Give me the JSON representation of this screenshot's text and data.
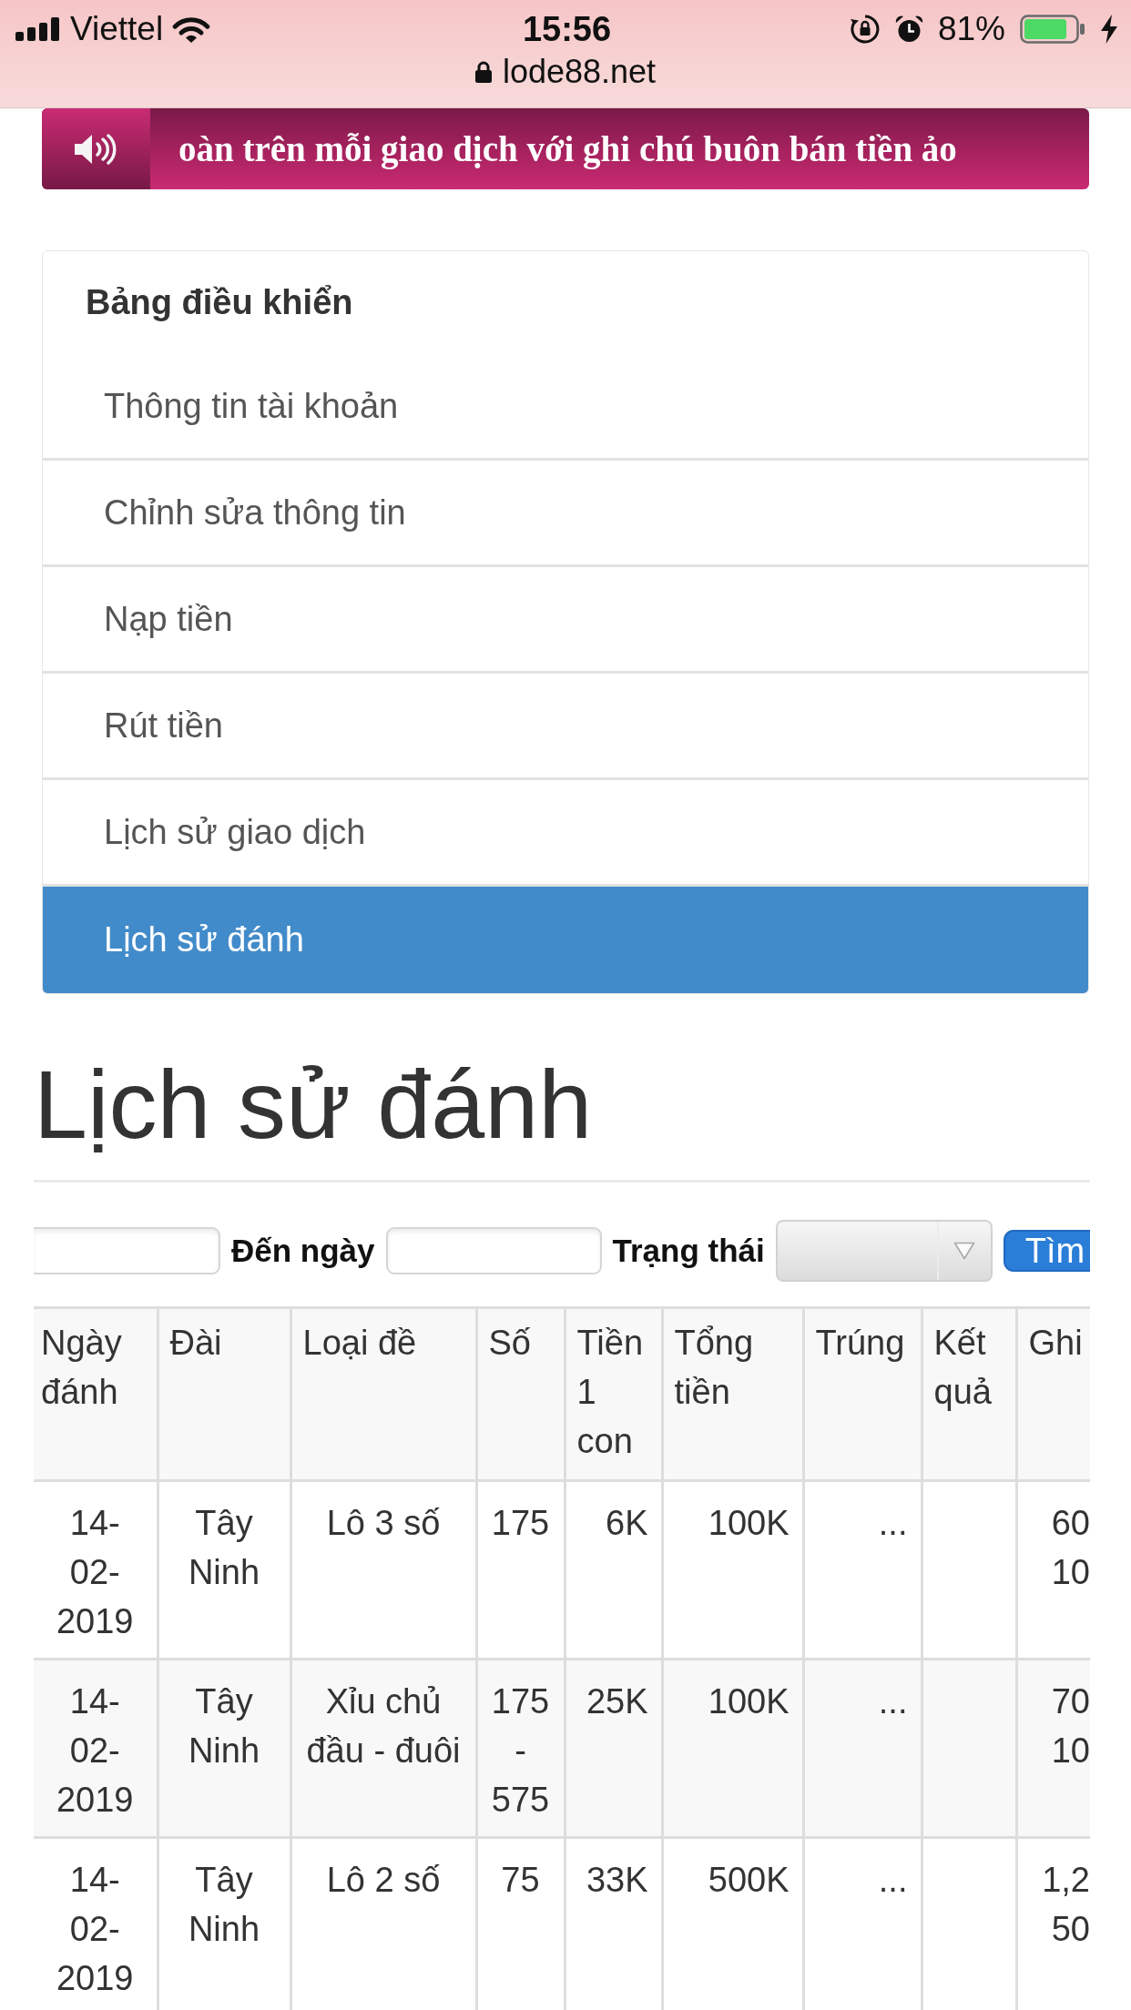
{
  "status_bar": {
    "carrier": "Viettel",
    "time": "15:56",
    "battery": "81%",
    "url": "lode88.net"
  },
  "banner": {
    "text": "oàn trên mỗi giao dịch với ghi chú buôn bán tiền ảo"
  },
  "sidebar": {
    "title": "Bảng điều khiển",
    "items": [
      {
        "label": "Thông tin tài khoản",
        "selected": false
      },
      {
        "label": "Chỉnh sửa thông tin",
        "selected": false
      },
      {
        "label": "Nạp tiền",
        "selected": false
      },
      {
        "label": "Rút tiền",
        "selected": false
      },
      {
        "label": "Lịch sử giao dịch",
        "selected": false
      },
      {
        "label": "Lịch sử đánh",
        "selected": true
      }
    ]
  },
  "page_title": "Lịch sử đánh",
  "filter_bar": {
    "items": [
      {
        "kind": "input"
      },
      {
        "kind": "label",
        "text": "Đến ngày"
      },
      {
        "kind": "input"
      },
      {
        "kind": "label",
        "text": "Trạng thái"
      },
      {
        "kind": "select"
      },
      {
        "kind": "button",
        "text": "Tìm"
      }
    ]
  },
  "table": {
    "columns": [
      "Ngày đánh",
      "Đài",
      "Loại đề",
      "Số",
      "Tiền 1 con",
      "Tổng tiền",
      "Trúng",
      "Kết quả",
      "Ghi"
    ],
    "rows": [
      [
        "14-02-2019",
        "Tây Ninh",
        "Lô 3 số",
        "175",
        "6K",
        "100K",
        "...",
        null,
        "60 10"
      ],
      [
        "14-02-2019",
        "Tây Ninh",
        "Xỉu chủ đầu - đuôi",
        "175 - 575",
        "25K",
        "100K",
        "...",
        null,
        "70 10"
      ],
      [
        "14-02-2019",
        "Tây Ninh",
        "Lô 2 số",
        "75",
        "33K",
        "500K",
        "...",
        null,
        "1,2 50"
      ]
    ]
  }
}
